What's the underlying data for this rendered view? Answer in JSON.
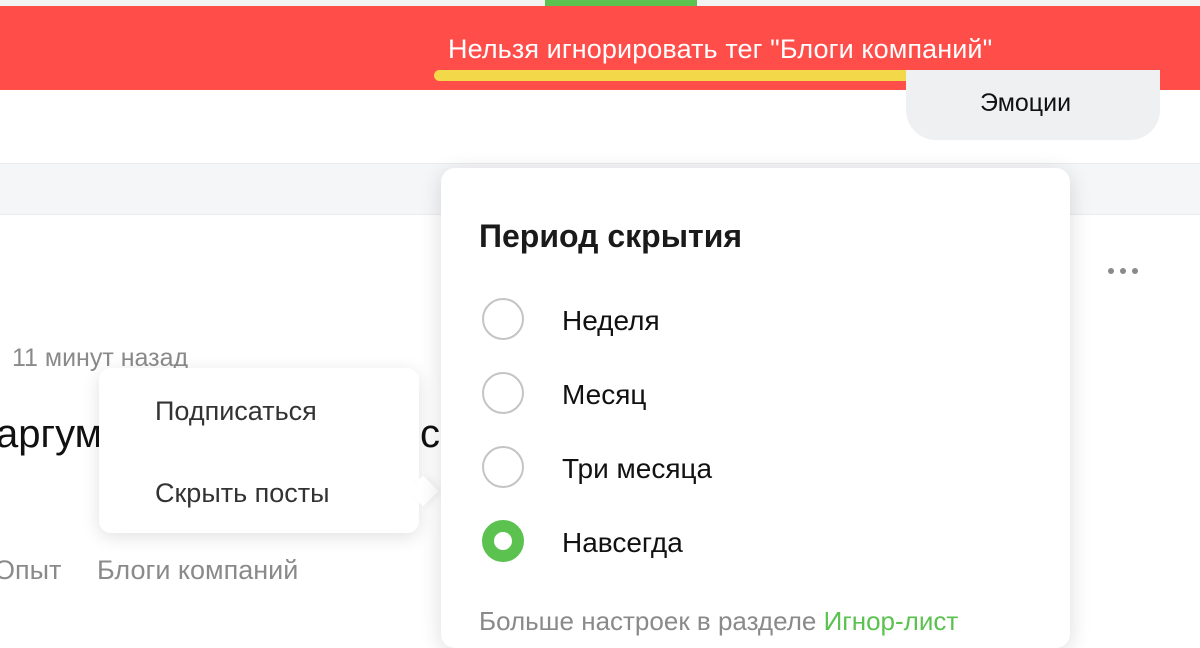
{
  "banner": {
    "message": "Нельзя игнорировать тег \"Блоги компаний\"",
    "color": "#ff4d4a",
    "highlight_color": "#f3d84a"
  },
  "header": {
    "emotion_tab": "Эмоции"
  },
  "post": {
    "time": "11 минут назад",
    "title_start": "аргум",
    "title_end": "с",
    "tags": [
      "Опыт",
      "Блоги компаний"
    ],
    "more_icon": "more-horizontal-icon"
  },
  "tag_menu": {
    "items": [
      "Подписаться",
      "Скрыть посты"
    ]
  },
  "period_popup": {
    "title": "Период скрытия",
    "options": [
      {
        "label": "Неделя",
        "checked": false
      },
      {
        "label": "Месяц",
        "checked": false
      },
      {
        "label": "Три месяца",
        "checked": false
      },
      {
        "label": "Навсегда",
        "checked": true
      }
    ],
    "footer_text": "Больше настроек в разделе ",
    "footer_link": "Игнор-лист",
    "accent_color": "#5bc250"
  }
}
